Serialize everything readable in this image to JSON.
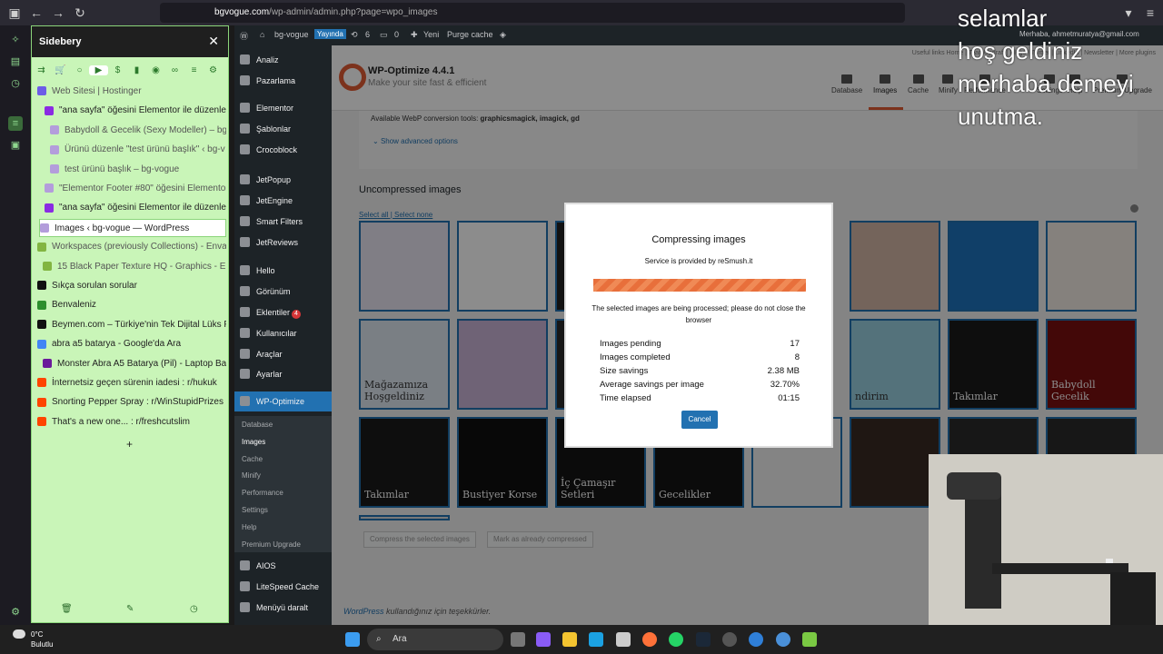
{
  "browser": {
    "url_host": "bgvogue.com",
    "url_path": "/wp-admin/admin.php?page=wpo_images"
  },
  "sidebery": {
    "title": "Sidebery",
    "tabs": [
      {
        "label": "Web Sitesi | Hostinger",
        "color": "#6c5ce7"
      },
      {
        "label": "\"ana sayfa\" öğesini Elementor ile düzenley",
        "color": "#8a2be2"
      },
      {
        "label": "Babydoll & Gecelik (Sexy Modeller) – bg",
        "color": "#b39ddb"
      },
      {
        "label": "Ürünü düzenle \"test ürünü başlık\" ‹ bg-v",
        "color": "#b39ddb"
      },
      {
        "label": "test ürünü başlık – bg-vogue",
        "color": "#b39ddb"
      },
      {
        "label": "\"Elementor Footer #80\" öğesini Elementor",
        "color": "#b39ddb"
      },
      {
        "label": "\"ana sayfa\" öğesini Elementor ile düzenley",
        "color": "#8a2be2"
      },
      {
        "label": "Images ‹ bg-vogue — WordPress",
        "color": "#b39ddb"
      },
      {
        "label": "Workspaces (previously Collections) - Envat",
        "color": "#82b541"
      },
      {
        "label": "15 Black Paper Texture HQ - Graphics - Env",
        "color": "#82b541"
      },
      {
        "label": "Sıkça sorulan sorular",
        "color": "#111111"
      },
      {
        "label": "Benvaleniz",
        "color": "#2d8f2d"
      },
      {
        "label": "Beymen.com – Türkiye'nin Tek Dijital Lüks P",
        "color": "#111111"
      },
      {
        "label": "abra a5 batarya - Google'da Ara",
        "color": "#4285f4"
      },
      {
        "label": "Monster Abra A5 Batarya (Pil) - Laptop Bat",
        "color": "#6a1b9a"
      },
      {
        "label": "İnternetsiz geçen sürenin iadesi : r/hukuk",
        "color": "#ff4500"
      },
      {
        "label": "Snorting Pepper Spray : r/WinStupidPrizes",
        "color": "#ff4500"
      },
      {
        "label": "That's a new one... : r/freshcutslim",
        "color": "#ff4500"
      }
    ],
    "add": "+"
  },
  "wpbar": {
    "site": "bg-vogue",
    "status": "Yayında",
    "updates": "6",
    "comments": "0",
    "new": "Yeni",
    "purge": "Purge cache",
    "greeting": "Merhaba, ahmetmuratya@gmail.com"
  },
  "wpmenu": {
    "items": [
      "Analiz",
      "Pazarlama",
      "Elementor",
      "Şablonlar",
      "Crocoblock",
      "JetPopup",
      "JetEngine",
      "Smart Filters",
      "JetReviews",
      "Hello",
      "Görünüm",
      "Eklentiler",
      "Kullanıcılar",
      "Araçlar",
      "Ayarlar",
      "WP-Optimize",
      "AIOS",
      "LiteSpeed Cache",
      "Menüyü daralt"
    ],
    "plugins_badge": "4",
    "sub": [
      "Database",
      "Images",
      "Cache",
      "Minify",
      "Performance",
      "Settings",
      "Help",
      "Premium Upgrade"
    ]
  },
  "plugin": {
    "title": "WP-Optimize 4.4.1",
    "subtitle": "Make your site fast & efficient",
    "toplinks": "Useful links     Home | TeamUpdraft | Blogs | Twitter | LinkedIn | Newsletter | More plugins",
    "tabs": [
      "Database",
      "Images",
      "Cache",
      "Minify",
      "Performance",
      "Settings",
      "Help",
      "Premium Upgrade"
    ],
    "webp_tools": "Available WebP conversion tools: ",
    "webp_tools_list": "graphicsmagick, imagick, gd",
    "advanced": "Show advanced options",
    "uncompressed": "Uncompressed images",
    "select_all": "Select all",
    "select_none": "Select none",
    "btn_compress": "Compress the selected images",
    "btn_mark": "Mark as already compressed",
    "footer_link": "WordPress",
    "footer_text": " kullandığınız için teşekkürler."
  },
  "thumbnails": [
    {
      "caption": "",
      "bg": "#e9e6f2"
    },
    {
      "caption": "",
      "bg": "#ffffff"
    },
    {
      "caption": "",
      "bg": "#222222"
    },
    {
      "caption": "",
      "bg": "#d8d0c8"
    },
    {
      "caption": "",
      "bg": "#d4b7a6"
    },
    {
      "caption": "",
      "bg": "#1e73be"
    },
    {
      "caption": "",
      "bg": "#f2ece4"
    },
    {
      "caption": "Mağazamıza Hoşgeldiniz",
      "bg": "#dfe7f0"
    },
    {
      "caption": "",
      "bg": "#cbb4d8"
    },
    {
      "caption": "",
      "bg": "#2a2a2a"
    },
    {
      "caption": "",
      "bg": "#ece7e4"
    },
    {
      "caption": "ndirim",
      "bg": "#9ad0e0"
    },
    {
      "caption": "Takımlar",
      "bg": "#1a1a1a"
    },
    {
      "caption": "Babydoll Gecelik",
      "bg": "#7a1010"
    },
    {
      "caption": "Takımlar",
      "bg": "#1a1a1a"
    },
    {
      "caption": "Bustiyer Korse",
      "bg": "#101010"
    },
    {
      "caption": "İç Çamaşır Setleri",
      "bg": "#151515"
    },
    {
      "caption": "Gecelikler",
      "bg": "#151515"
    },
    {
      "caption": "",
      "bg": "#f0f0f1"
    },
    {
      "caption": "",
      "bg": "#3a2a24"
    },
    {
      "caption": "",
      "bg": "#2b2b2b"
    },
    {
      "caption": "",
      "bg": "#2b2b2b"
    }
  ],
  "modal": {
    "title": "Compressing images",
    "service": "Service is provided by reSmush.it",
    "progress": 1.0,
    "note": "The selected images are being processed; please do not close the browser",
    "stats": [
      {
        "label": "Images pending",
        "value": "17"
      },
      {
        "label": "Images completed",
        "value": "8"
      },
      {
        "label": "Size savings",
        "value": "2.38 MB"
      },
      {
        "label": "Average savings per image",
        "value": "32.70%"
      },
      {
        "label": "Time elapsed",
        "value": "01:15"
      }
    ],
    "cancel": "Cancel"
  },
  "caption": [
    "selamlar",
    "hoş geldiniz",
    "merhaba demeyi",
    "unutma."
  ],
  "taskbar": {
    "weather_temp": "0°C",
    "weather_desc": "Bulutlu",
    "search": "Ara"
  }
}
